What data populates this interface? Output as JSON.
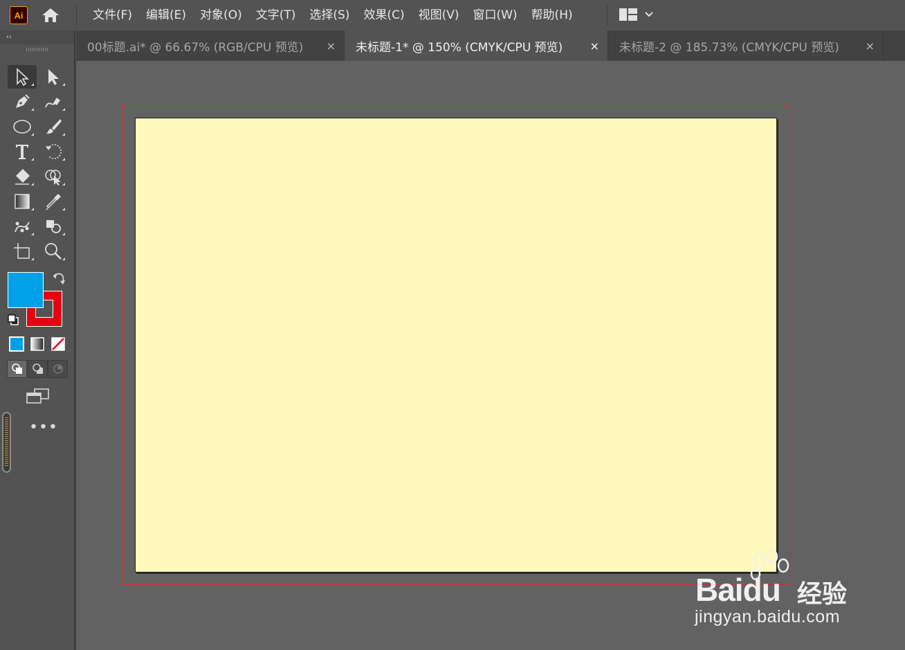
{
  "app": {
    "logo_text": "Ai",
    "menu": [
      "文件(F)",
      "编辑(E)",
      "对象(O)",
      "文字(T)",
      "选择(S)",
      "效果(C)",
      "视图(V)",
      "窗口(W)",
      "帮助(H)"
    ]
  },
  "toolbar": {
    "collapse": "‹‹",
    "more": "•••",
    "fill_color": "#00a0e9",
    "stroke_color": "#e60012"
  },
  "tabs": [
    {
      "label": "00标题.ai* @ 66.67% (RGB/CPU 预览)",
      "close": "×",
      "active": false
    },
    {
      "label": "未标题-1* @ 150% (CMYK/CPU 预览)",
      "close": "×",
      "active": true
    },
    {
      "label": "未标题-2 @ 185.73% (CMYK/CPU 预览)",
      "close": "×",
      "active": false
    }
  ],
  "canvas": {
    "artboard_color": "#fffabb",
    "bleed_color": "#e0262a"
  },
  "watermark": {
    "brand": "Bai",
    "brand_du": "du",
    "brand_cn": "经验",
    "url": "jingyan.baidu.com"
  }
}
